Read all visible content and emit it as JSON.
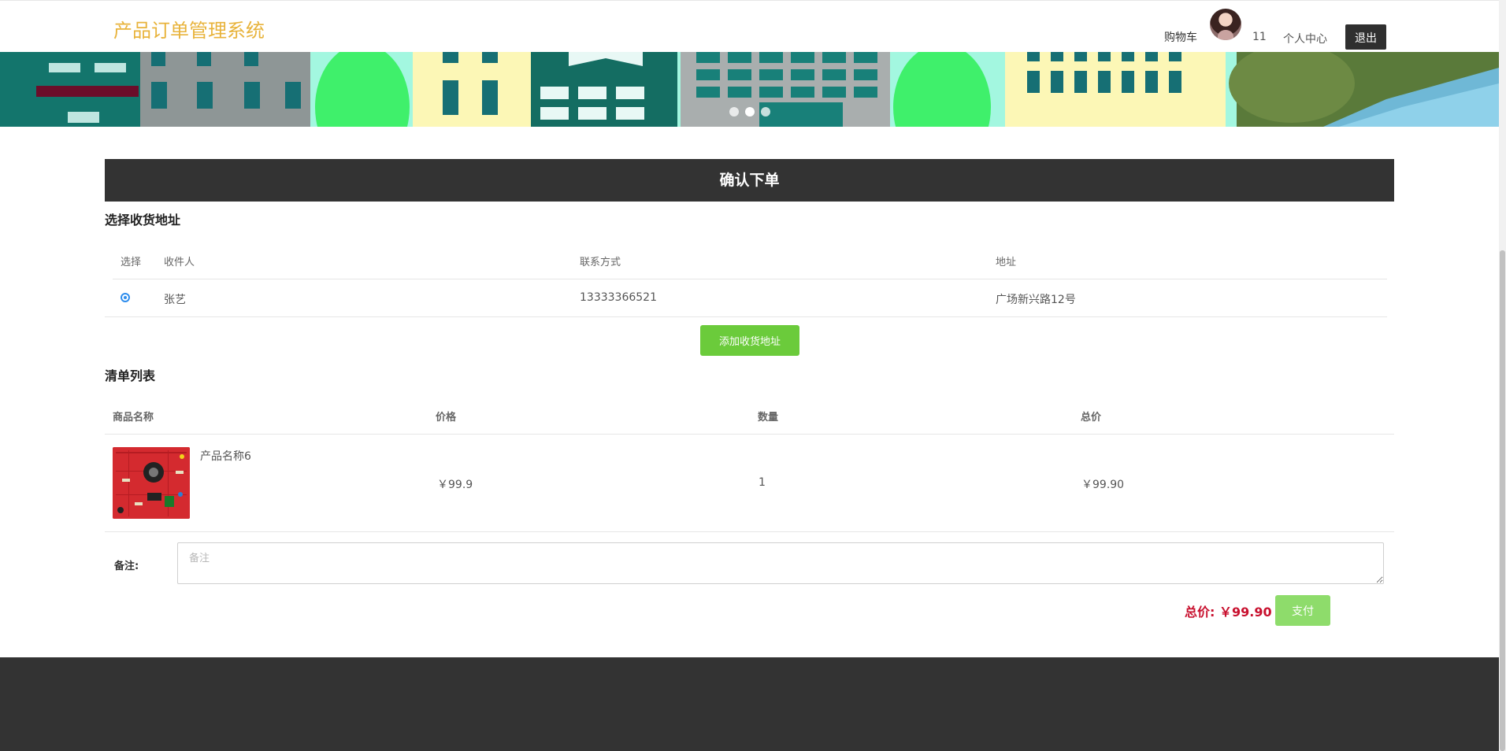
{
  "header": {
    "site_title": "产品订单管理系统",
    "cart_label": "购物车",
    "username": "11",
    "profile_label": "个人中心",
    "logout_label": "退出"
  },
  "banner": {
    "slide_count": 3,
    "active_slide": 2
  },
  "confirm": {
    "title": "确认下单"
  },
  "address": {
    "section_title": "选择收货地址",
    "columns": [
      "选择",
      "收件人",
      "联系方式",
      "地址"
    ],
    "rows": [
      {
        "selected": true,
        "recipient": "张艺",
        "phone": "13333366521",
        "address": "广场新兴路12号"
      }
    ],
    "add_button": "添加收货地址"
  },
  "order_list": {
    "section_title": "清单列表",
    "columns": [
      "商品名称",
      "价格",
      "数量",
      "总价"
    ],
    "rows": [
      {
        "name": "产品名称6",
        "price": "￥99.9",
        "quantity": "1",
        "total": "￥99.90"
      }
    ]
  },
  "remark": {
    "label": "备注:",
    "placeholder": "备注"
  },
  "summary": {
    "total_label": "总价: ￥99.90",
    "pay_button": "支付"
  },
  "colors": {
    "title": "#e8b33b",
    "bar": "#333333",
    "primary_green": "#6bcb3b",
    "price_red": "#c8102e"
  }
}
